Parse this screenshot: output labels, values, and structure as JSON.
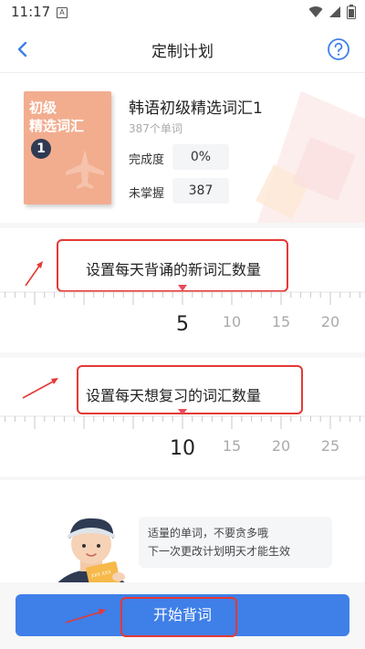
{
  "status_bar": {
    "time": "11:17",
    "notif_letter": "A"
  },
  "header": {
    "title": "定制计划"
  },
  "book": {
    "cover_line1": "初级",
    "cover_line2": "精选词汇",
    "cover_number": "1",
    "title": "韩语初级精选词汇1",
    "word_count": "387个单词",
    "completion_label": "完成度",
    "completion_value": "0%",
    "unmastered_label": "未掌握",
    "unmastered_value": "387"
  },
  "new_words": {
    "heading": "设置每天背诵的新词汇数量",
    "ticks": [
      "5",
      "10",
      "15",
      "20"
    ],
    "selected": "5"
  },
  "review_words": {
    "heading": "设置每天想复习的词汇数量",
    "ticks": [
      "10",
      "15",
      "20",
      "25"
    ],
    "selected": "10"
  },
  "tip": {
    "line1": "适量的单词，不要贪多哦",
    "line2": "下一次更改计划明天才能生效"
  },
  "footer": {
    "start_label": "开始背词"
  },
  "colors": {
    "accent": "#3f7fe8",
    "annotation": "#e53935",
    "cover": "#f2ad8f",
    "pointer": "#e84c5a"
  },
  "icons": {
    "back": "chevron-left-icon",
    "help": "question-circle-icon",
    "wifi": "wifi-icon",
    "signal": "signal-icon",
    "battery": "battery-icon"
  }
}
